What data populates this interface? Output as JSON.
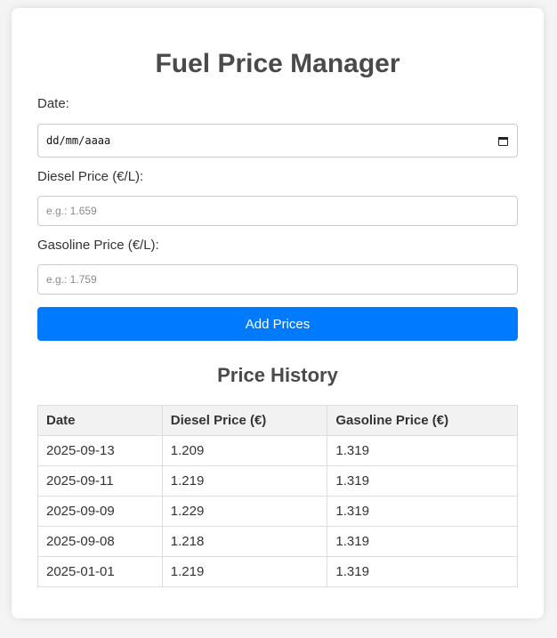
{
  "title": "Fuel Price Manager",
  "form": {
    "date_label": "Date:",
    "date_value": "dd/mm/aaaa",
    "diesel_label": "Diesel Price (€/L):",
    "diesel_placeholder": "e.g.: 1.659",
    "gasoline_label": "Gasoline Price (€/L):",
    "gasoline_placeholder": "e.g.: 1.759",
    "submit_label": "Add Prices",
    "calendar_icon": "calendar-icon"
  },
  "history": {
    "title": "Price History",
    "columns": [
      "Date",
      "Diesel Price (€)",
      "Gasoline Price (€)"
    ],
    "rows": [
      [
        "2025-09-13",
        "1.209",
        "1.319"
      ],
      [
        "2025-09-11",
        "1.219",
        "1.319"
      ],
      [
        "2025-09-09",
        "1.229",
        "1.319"
      ],
      [
        "2025-09-08",
        "1.218",
        "1.319"
      ],
      [
        "2025-01-01",
        "1.219",
        "1.319"
      ]
    ]
  },
  "colors": {
    "accent": "#007bff",
    "background": "#f4f4f4",
    "card": "#ffffff",
    "table_header": "#f2f2f2"
  }
}
